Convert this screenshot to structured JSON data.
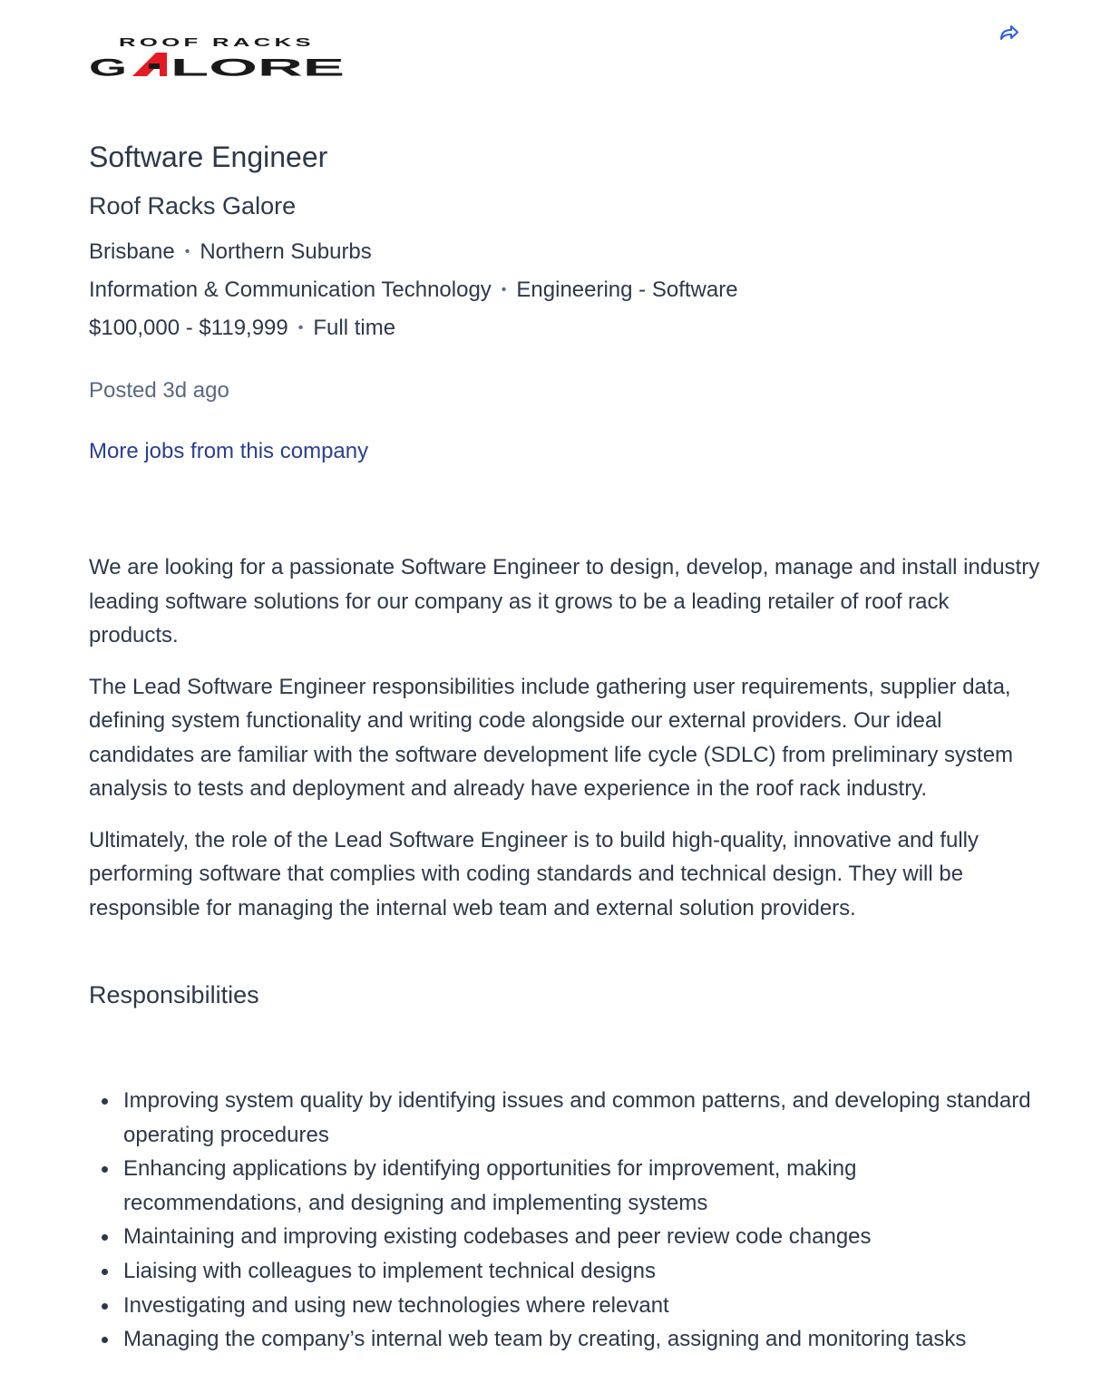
{
  "logo": {
    "line1": "ROOF RACKS",
    "line2_a": "G",
    "line2_b": "LORE",
    "accent_color": "#e31b23",
    "text_color": "#1a1a1a"
  },
  "share": {
    "icon": "share-arrow-icon",
    "color": "#2b5fd9"
  },
  "job": {
    "title": "Software Engineer",
    "company": "Roof Racks Galore",
    "location": "Brisbane",
    "area": "Northern Suburbs",
    "classification": "Information & Communication Technology",
    "subclassification": "Engineering - Software",
    "salary": "$100,000 - $119,999",
    "work_type": "Full time",
    "posted": "Posted 3d ago",
    "more_jobs_link": "More jobs from this company"
  },
  "description": {
    "paragraphs": [
      "We are looking for a passionate Software Engineer to design, develop, manage and install industry leading software solutions for our company as it grows to be a leading retailer of roof rack products.",
      "The Lead Software Engineer responsibilities include gathering user requirements, supplier data, defining system functionality and writing code alongside our external providers. Our ideal candidates are familiar with the software development life cycle (SDLC) from preliminary system analysis to tests and deployment and already have experience in the roof rack industry.",
      "Ultimately, the role of the Lead Software Engineer is to build high-quality, innovative and fully performing software that complies with coding standards and technical design. They will be responsible for managing the internal web team and external solution providers."
    ],
    "responsibilities_heading": "Responsibilities",
    "responsibilities": [
      "Improving system quality by identifying issues and common patterns, and developing standard operating procedures",
      "Enhancing applications by identifying opportunities for improvement, making recommendations, and designing and implementing systems",
      "Maintaining and improving existing codebases and peer review code changes",
      "Liaising with colleagues to implement technical designs",
      "Investigating and using new technologies where relevant",
      "Managing the company’s internal web team by creating, assigning and monitoring tasks"
    ]
  },
  "colors": {
    "text": "#2e3849",
    "muted": "#5a6881",
    "link": "#2b3f8f"
  }
}
